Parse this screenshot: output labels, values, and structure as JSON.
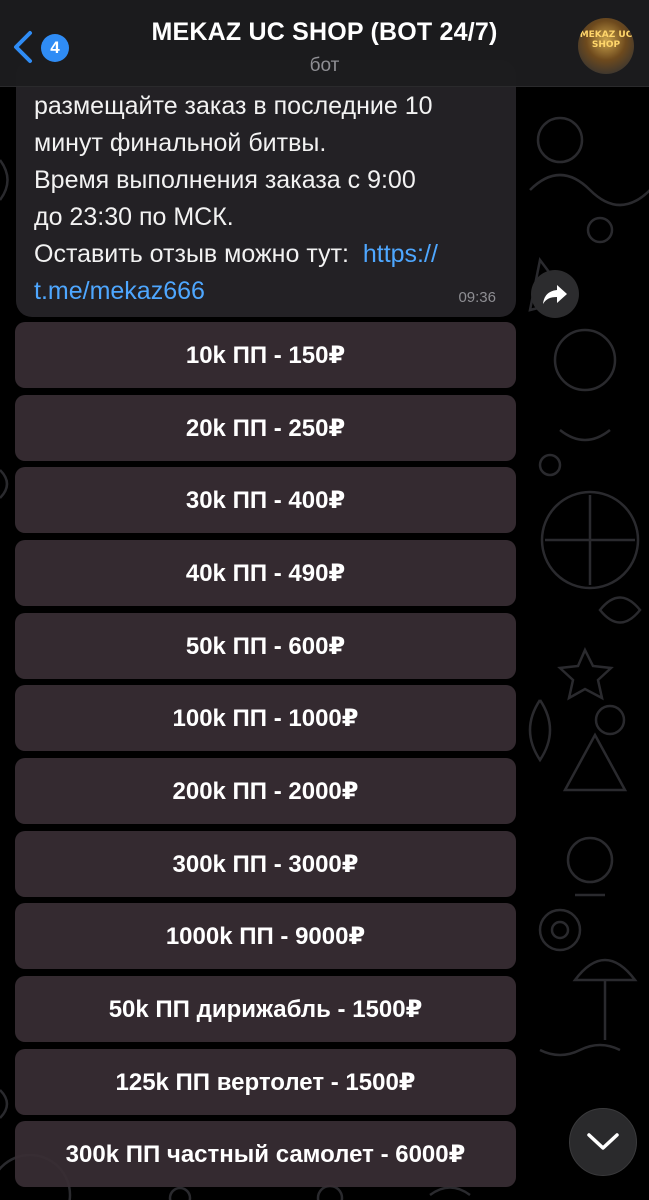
{
  "header": {
    "back_badge": "4",
    "title": "MEKAZ UC SHOP (BOT 24/7)",
    "subtitle": "бот",
    "avatar_text": "MEKAZ UC SHOP"
  },
  "message": {
    "lines": [
      "размещайте заказ в последние 10",
      "минут финальной битвы.",
      "Время выполнения заказа с 9:00",
      "до 23:30 по МСК.",
      "Оставить отзыв можно тут:  "
    ],
    "link_part1": "https://",
    "link_part2": "t.me/mekaz666",
    "time": "09:36"
  },
  "keyboard": [
    "10k ПП - 150₽",
    "20k ПП - 250₽",
    "30k ПП - 400₽",
    "40k ПП - 490₽",
    "50k ПП - 600₽",
    "100k ПП - 1000₽",
    "200k ПП - 2000₽",
    "300k ПП - 3000₽",
    "1000k ПП - 9000₽",
    "50k ПП дирижабль - 1500₽",
    "125k ПП вертолет - 1500₽",
    "300k ПП частный самолет - 6000₽"
  ],
  "colors": {
    "accent": "#2f8cf5",
    "link": "#4ea7ff",
    "bubble": "#232125",
    "button": "#382e34"
  },
  "icons": {
    "back": "chevron-left-icon",
    "share": "share-arrow-icon",
    "scroll": "chevron-down-icon"
  }
}
